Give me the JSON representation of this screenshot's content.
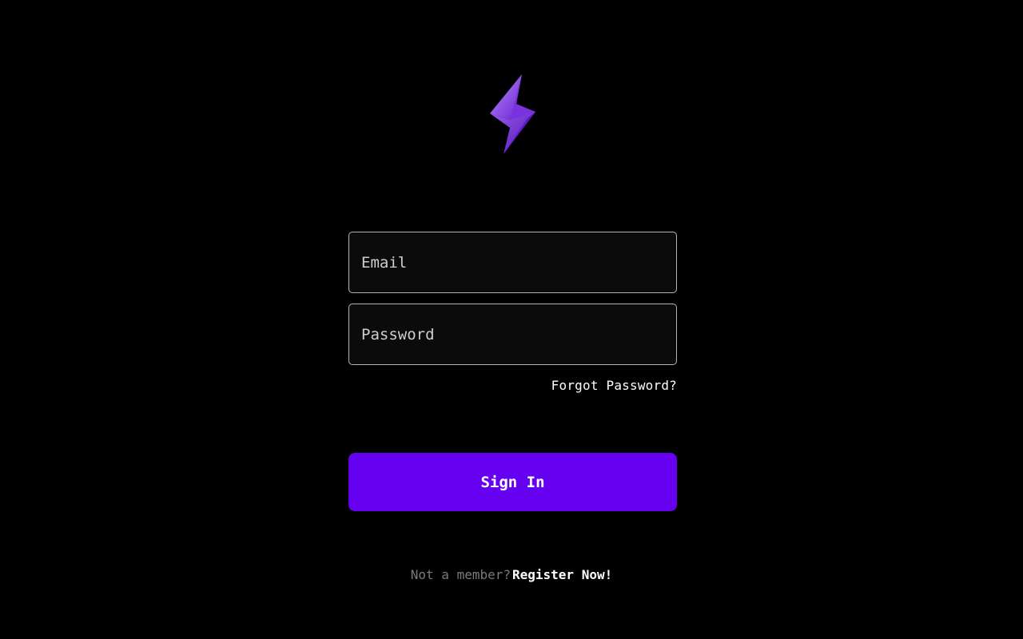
{
  "brand": {
    "logo_icon": "lightning-bolt-icon",
    "accent_color": "#6600f0",
    "logo_color": "#8b3ff0"
  },
  "form": {
    "email_placeholder": "Email",
    "email_value": "",
    "password_placeholder": "Password",
    "password_value": "",
    "forgot_password_label": "Forgot Password?",
    "sign_in_label": "Sign In"
  },
  "footer": {
    "prompt_text": "Not a member?",
    "register_label": "Register Now!"
  }
}
